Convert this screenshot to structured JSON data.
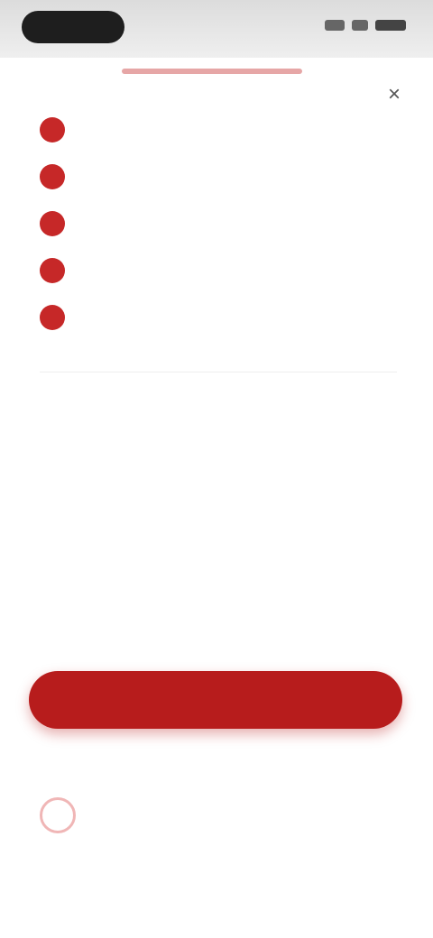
{
  "status_bar": {
    "pill": ""
  },
  "header": {
    "close_icon": "close-icon"
  },
  "items": [
    {
      "text": "",
      "value": ""
    },
    {
      "text": "",
      "value": ""
    },
    {
      "text": "",
      "value": ""
    },
    {
      "text": "",
      "value": ""
    },
    {
      "text": "",
      "value": ""
    }
  ],
  "link_text": "",
  "total": {
    "label": "",
    "value": ""
  },
  "promo": {
    "title": "",
    "value": ""
  },
  "tabs": [
    "",
    "",
    ""
  ],
  "cta": {
    "label": "",
    "subtext": ""
  },
  "notice": {
    "title": "",
    "subtitle": ""
  },
  "footer": "",
  "colors": {
    "accent": "#b71c1c",
    "accent_light": "#d84848",
    "pill": "#1e1e1e"
  }
}
